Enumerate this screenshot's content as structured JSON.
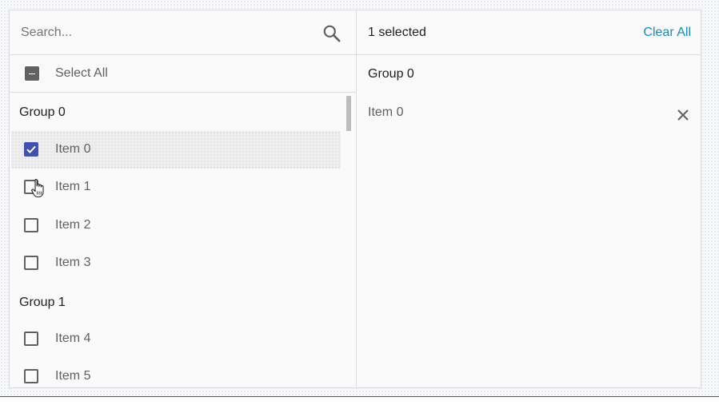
{
  "search": {
    "placeholder": "Search...",
    "value": "",
    "icon": "search-icon"
  },
  "select_all": {
    "label": "Select All",
    "state": "indeterminate"
  },
  "groups": [
    {
      "label": "Group 0",
      "items": [
        {
          "label": "Item 0",
          "checked": true
        },
        {
          "label": "Item 1",
          "checked": false
        },
        {
          "label": "Item 2",
          "checked": false
        },
        {
          "label": "Item 3",
          "checked": false
        }
      ]
    },
    {
      "label": "Group 1",
      "items": [
        {
          "label": "Item 4",
          "checked": false
        },
        {
          "label": "Item 5",
          "checked": false
        }
      ]
    }
  ],
  "summary": {
    "selected_text": "1 selected",
    "clear_label": "Clear All"
  },
  "selected": {
    "group_label": "Group 0",
    "items": [
      {
        "label": "Item 0",
        "remove_icon": "close-icon"
      }
    ]
  },
  "colors": {
    "accent": "#3f51b5",
    "link": "#1a8bc1",
    "checkbox_border": "#616161",
    "divider": "#dcdcdc"
  }
}
